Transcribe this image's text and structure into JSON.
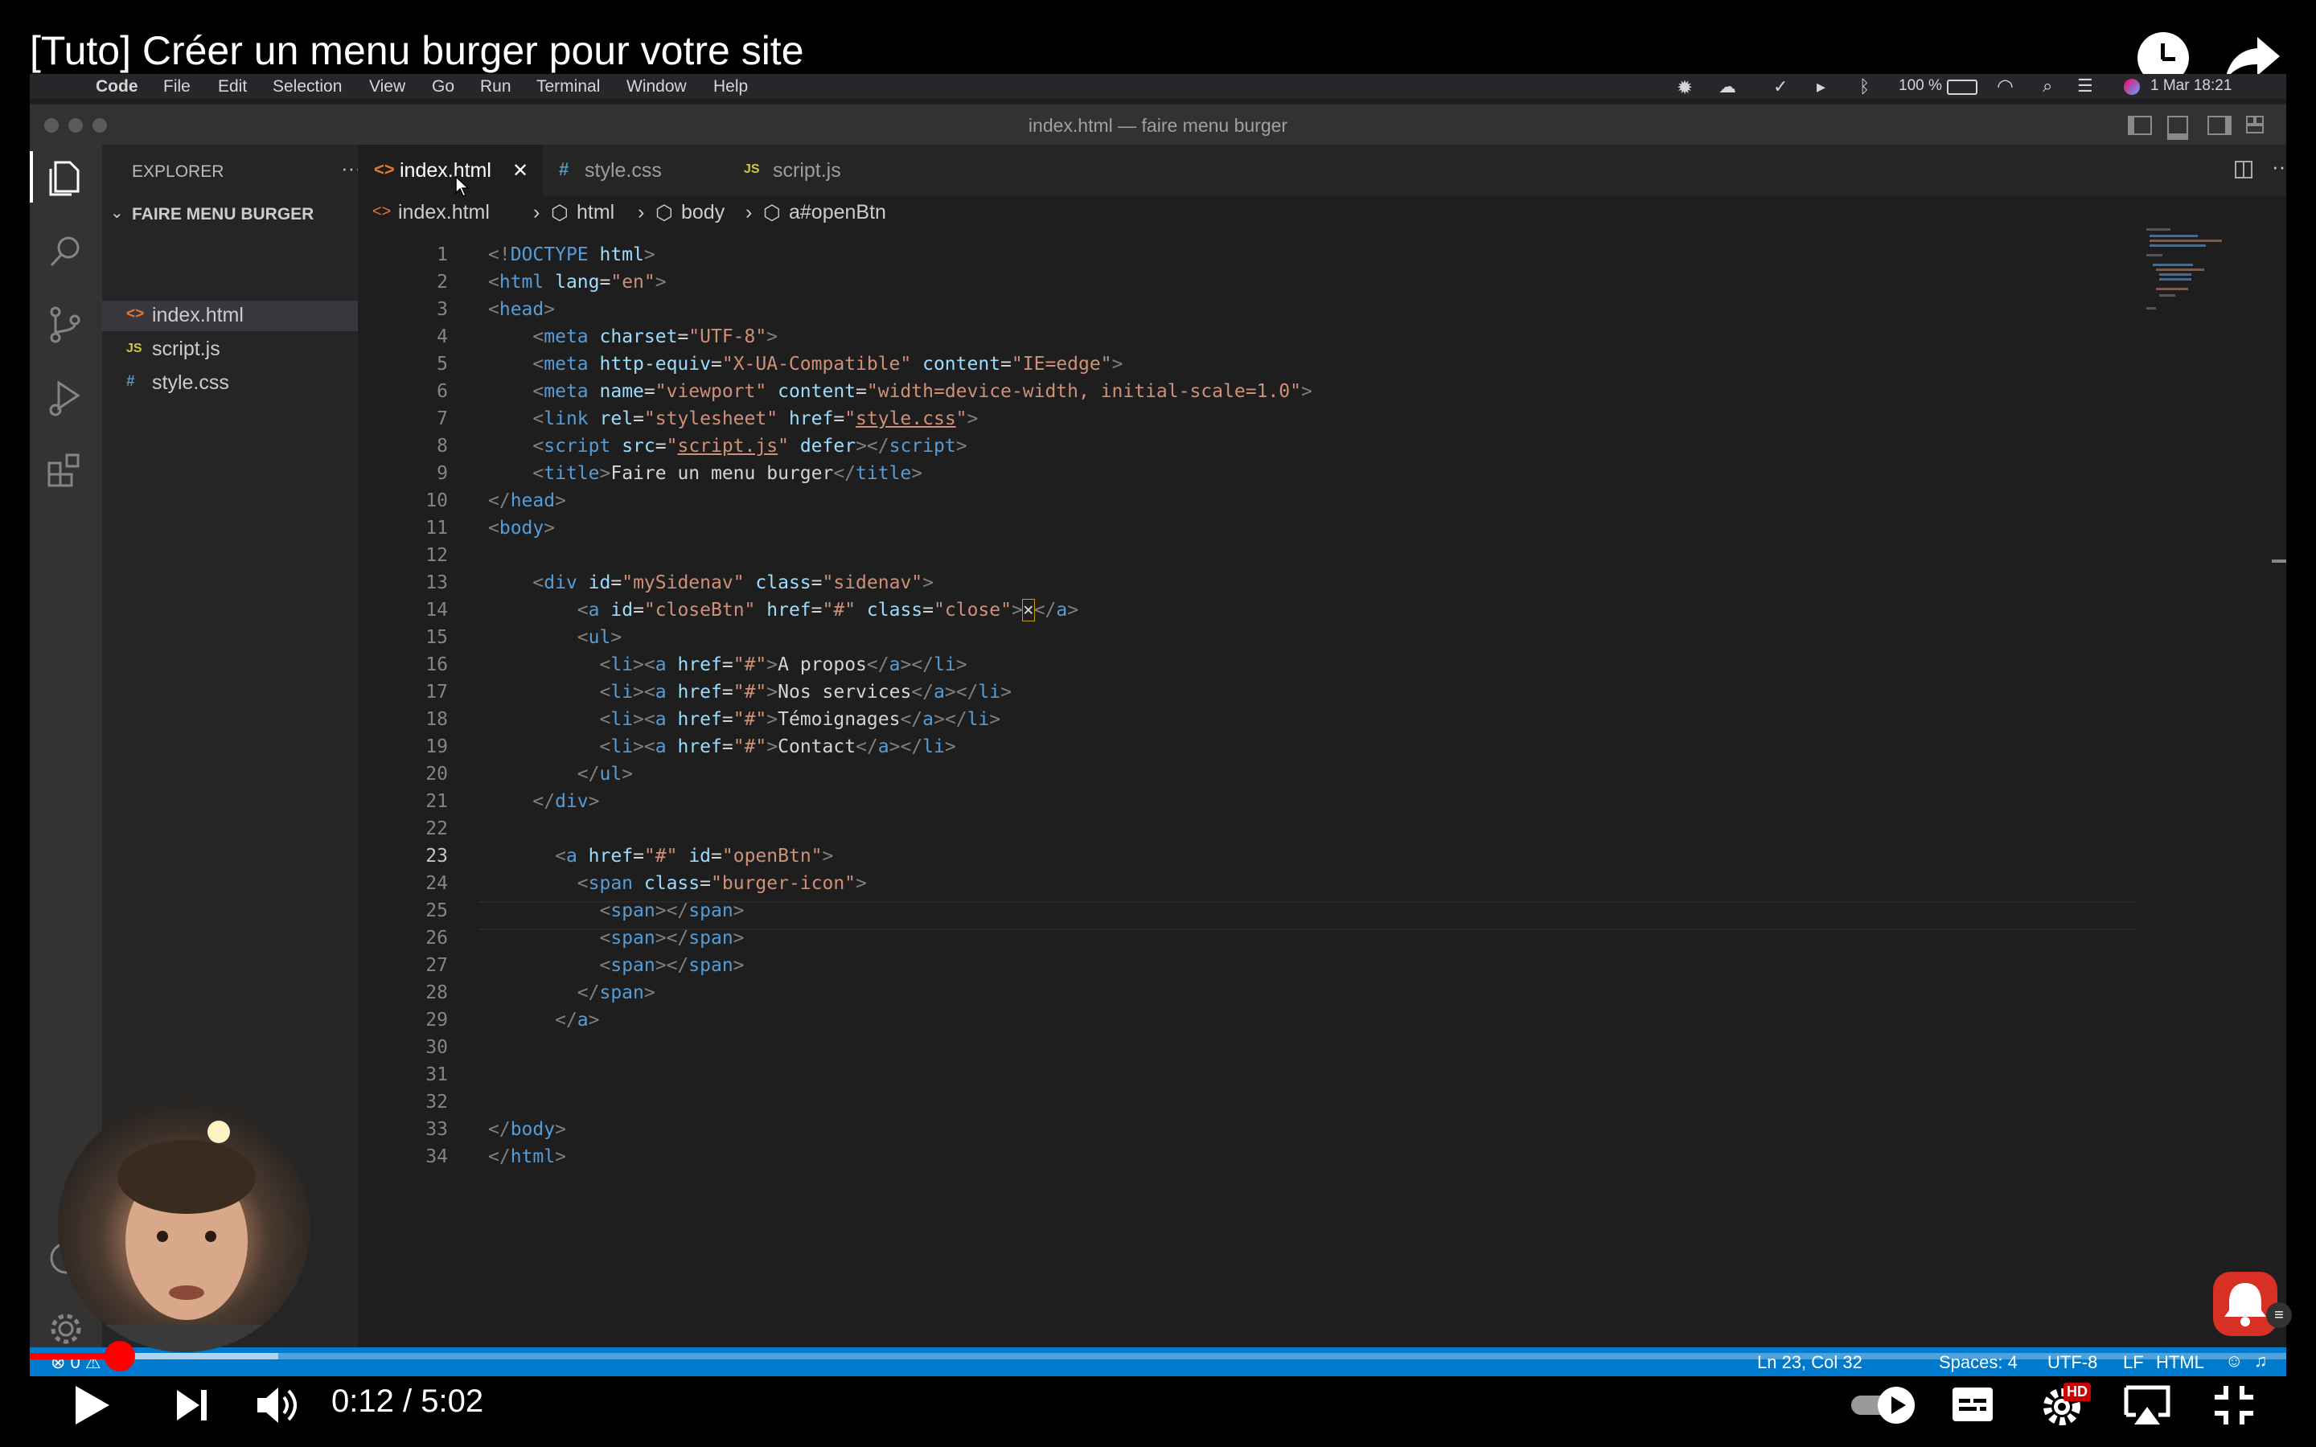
{
  "video": {
    "title": "[Tuto] Créer un menu burger pour votre site",
    "time_current": "0:12",
    "time_separator": "/",
    "time_total": "5:02",
    "progress_fraction": 0.04,
    "buffered_fraction": 0.11,
    "hd_badge": "HD"
  },
  "menubar": {
    "items": [
      "Code",
      "File",
      "Edit",
      "Selection",
      "View",
      "Go",
      "Run",
      "Terminal",
      "Window",
      "Help"
    ],
    "battery": "100 %",
    "clock": "1 Mar  18:21"
  },
  "window": {
    "title": "index.html — faire menu burger"
  },
  "explorer": {
    "title": "EXPLORER",
    "more": "···",
    "folder": "FAIRE MENU BURGER",
    "files": [
      {
        "icon": "<>",
        "name": "index.html"
      },
      {
        "icon": "JS",
        "name": "script.js"
      },
      {
        "icon": "#",
        "name": "style.css"
      }
    ]
  },
  "tabs": [
    {
      "icon": "<>",
      "name": "index.html",
      "close": "✕"
    },
    {
      "icon": "#",
      "name": "style.css"
    },
    {
      "icon": "JS",
      "name": "script.js"
    }
  ],
  "breadcrumb": [
    "index.html",
    "html",
    "body",
    "a#openBtn"
  ],
  "code_lines": [
    "1",
    "2",
    "3",
    "4",
    "5",
    "6",
    "7",
    "8",
    "9",
    "10",
    "11",
    "12",
    "13",
    "14",
    "15",
    "16",
    "17",
    "18",
    "19",
    "20",
    "21",
    "22",
    "23",
    "24",
    "25",
    "26",
    "27",
    "28",
    "29",
    "30",
    "31",
    "32",
    "33",
    "34"
  ],
  "code": {
    "l1a": "<!",
    "l1b": "DOCTYPE",
    "l1c": " html",
    "l1d": ">",
    "html": "html",
    "lang": "lang",
    "en": "\"en\"",
    "head": "head",
    "meta": "meta",
    "charset": "charset",
    "utf8": "\"UTF-8\"",
    "httpequiv": "http-equiv",
    "xua": "\"X-UA-Compatible\"",
    "content": "content",
    "ieedge": "\"IE=edge\"",
    "name": "name",
    "viewport": "\"viewport\"",
    "vpcontent": "\"width=device-width, initial-scale=1.0\"",
    "link": "link",
    "rel": "rel",
    "stylesheet": "\"stylesheet\"",
    "href": "href",
    "stylecss": "style.css",
    "script": "script",
    "src": "src",
    "scriptjs": "script.js",
    "defer": "defer",
    "title": "title",
    "titletext": "Faire un menu burger",
    "body": "body",
    "div": "div",
    "id": "id",
    "mysidenav": "\"mySidenav\"",
    "class": "class",
    "sidenav": "\"sidenav\"",
    "a": "a",
    "closebtn": "\"closeBtn\"",
    "hash": "\"#\"",
    "close": "\"close\"",
    "times": "×",
    "ul": "ul",
    "li": "li",
    "apropos": "A propos",
    "services": "Nos services",
    "temoignages": "Témoignages",
    "contact": "Contact",
    "openbtn": "\"openBtn\"",
    "span": "span",
    "burgericon": "\"burger-icon\""
  },
  "status": {
    "errors": "⊗ 0 ⚠",
    "position": "Ln 23, Col 32",
    "spaces": "Spaces: 4",
    "encoding": "UTF-8",
    "eol": "LF",
    "language": "HTML"
  }
}
